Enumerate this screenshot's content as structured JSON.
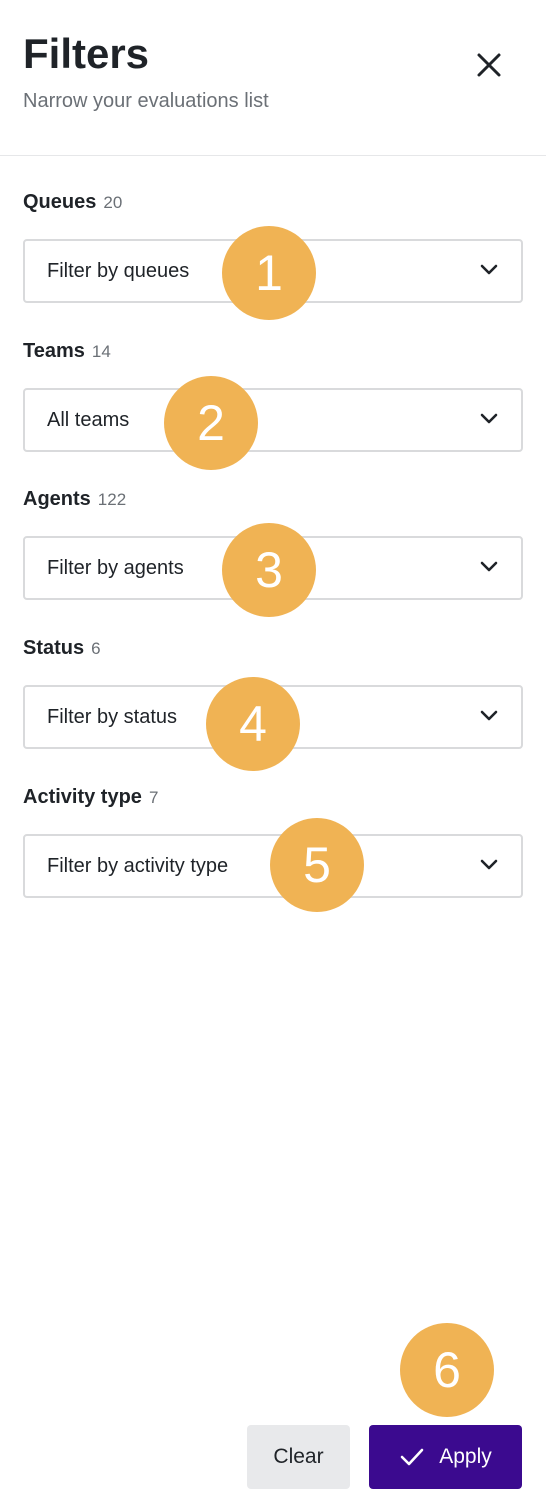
{
  "header": {
    "title": "Filters",
    "subtitle": "Narrow your evaluations list",
    "close_icon": "close-icon"
  },
  "filters": [
    {
      "label": "Queues",
      "count": "20",
      "value": "Filter by queues",
      "badge": "1"
    },
    {
      "label": "Teams",
      "count": "14",
      "value": "All teams",
      "badge": "2"
    },
    {
      "label": "Agents",
      "count": "122",
      "value": "Filter by agents",
      "badge": "3"
    },
    {
      "label": "Status",
      "count": "6",
      "value": "Filter by status",
      "badge": "4"
    },
    {
      "label": "Activity type",
      "count": "7",
      "value": "Filter by activity type",
      "badge": "5"
    }
  ],
  "footer": {
    "clear_label": "Clear",
    "apply_label": "Apply",
    "apply_badge": "6"
  },
  "colors": {
    "accent": "#3b0a8f",
    "badge": "#f0b354",
    "border": "#d9dadc",
    "clear_bg": "#e8e9eb"
  }
}
